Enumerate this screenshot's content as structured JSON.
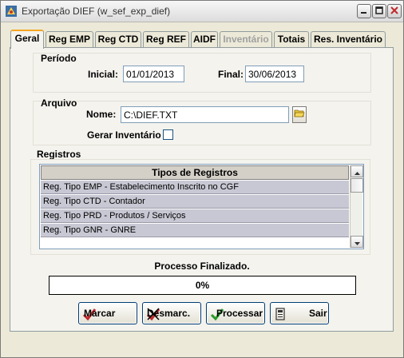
{
  "window": {
    "title": "Exportação DIEF (w_sef_exp_dief)"
  },
  "tabs": [
    {
      "label": "Geral"
    },
    {
      "label": "Reg EMP"
    },
    {
      "label": "Reg CTD"
    },
    {
      "label": "Reg REF"
    },
    {
      "label": "AIDF"
    },
    {
      "label": "Inventário"
    },
    {
      "label": "Totais"
    },
    {
      "label": "Res. Inventário"
    }
  ],
  "periodo": {
    "group_label": "Período",
    "inicial_label": "Inicial:",
    "inicial_value": "01/01/2013",
    "final_label": "Final:",
    "final_value": "30/06/2013"
  },
  "arquivo": {
    "group_label": "Arquivo",
    "nome_label": "Nome:",
    "nome_value": "C:\\DIEF.TXT",
    "gerar_label": "Gerar Inventário",
    "gerar_checked": false
  },
  "registros": {
    "group_label": "Registros",
    "column_header": "Tipos de Registros",
    "rows": [
      "Reg. Tipo EMP - Estabelecimento Inscrito no CGF",
      "Reg. Tipo CTD - Contador",
      "Reg. Tipo PRD - Produtos / Serviços",
      "Reg. Tipo GNR - GNRE"
    ]
  },
  "status_text": "Processo Finalizado.",
  "progress": {
    "value": 0,
    "label": "0%"
  },
  "buttons": {
    "marcar": "Marcar",
    "desmarcar": "Desmarc.",
    "processar": "Processar",
    "sair": "Sair"
  }
}
